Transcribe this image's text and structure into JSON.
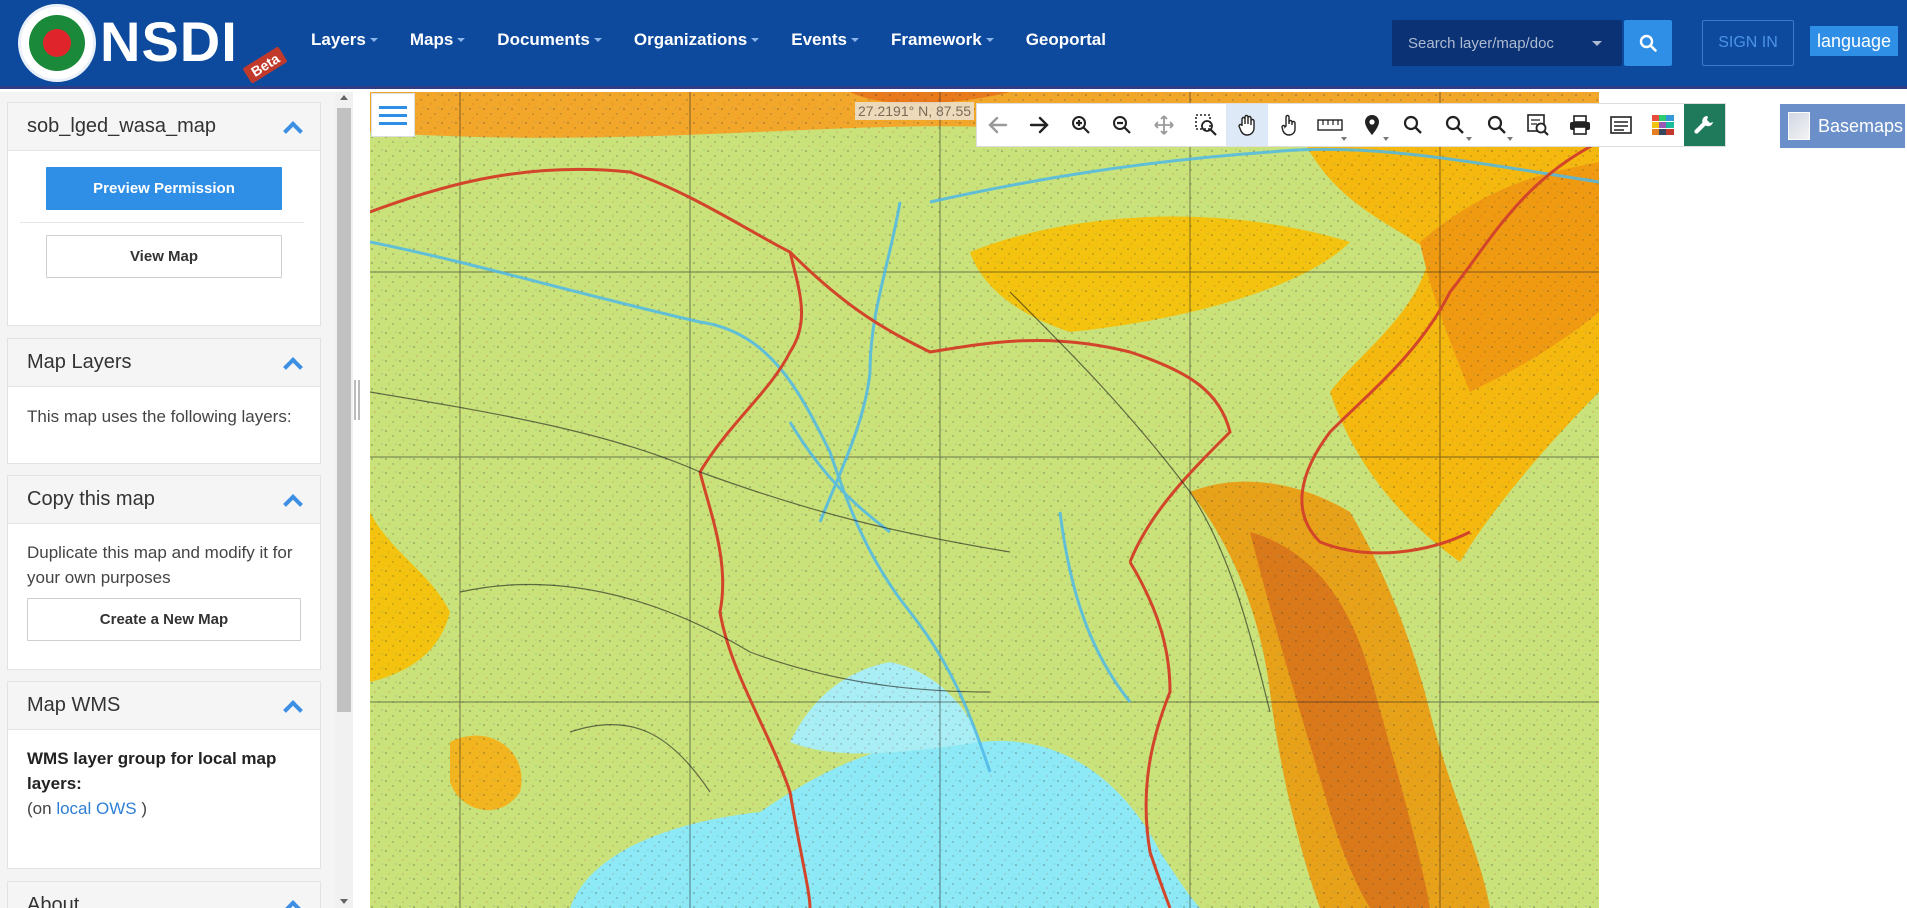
{
  "header": {
    "logo_text": "NSDI",
    "beta_label": "Beta",
    "logo_seal_text": "গণপ্রজাতন্ত্রী বাংলাদেশ সরকার",
    "nav": [
      {
        "label": "Layers",
        "dropdown": true
      },
      {
        "label": "Maps",
        "dropdown": true
      },
      {
        "label": "Documents",
        "dropdown": true
      },
      {
        "label": "Organizations",
        "dropdown": true
      },
      {
        "label": "Events",
        "dropdown": true
      },
      {
        "label": "Framework",
        "dropdown": true
      },
      {
        "label": "Geoportal",
        "dropdown": false
      }
    ],
    "search_placeholder": "Search layer/map/doc",
    "signin_label": "SIGN IN",
    "language_label": "language"
  },
  "sidebar": {
    "map_panel": {
      "title": "sob_lged_wasa_map",
      "preview_button": "Preview Permission",
      "view_button": "View Map"
    },
    "layers_panel": {
      "title": "Map Layers",
      "text": "This map uses the following layers:"
    },
    "copy_panel": {
      "title": "Copy this map",
      "text": "Duplicate this map and modify it for your own purposes",
      "button": "Create a New Map"
    },
    "wms_panel": {
      "title": "Map WMS",
      "heading": "WMS layer group for local map layers:",
      "prefix": "(on",
      "link": "local OWS",
      "suffix": ")"
    },
    "about_panel": {
      "title": "About"
    }
  },
  "map": {
    "coordinate_readout": "27.2191° N, 87.55",
    "basemaps_label": "Basemaps",
    "tools": [
      "back-arrow-icon",
      "forward-arrow-icon",
      "zoom-in-icon",
      "zoom-out-icon",
      "pan-icon",
      "zoom-box-icon",
      "drag-hand-icon",
      "pointer-hand-icon",
      "measure-ruler-icon",
      "location-pin-icon",
      "search-icon",
      "search-dropdown-icon",
      "search-options-icon",
      "zoom-extent-icon",
      "print-icon",
      "legend-icon",
      "color-grid-icon",
      "wrench-icon"
    ],
    "colors": {
      "land": "#c9e27a",
      "highland": "#f2c20a",
      "water": "#8de9f5",
      "border": "#d2452a",
      "accent": "#2f8ee6"
    }
  }
}
